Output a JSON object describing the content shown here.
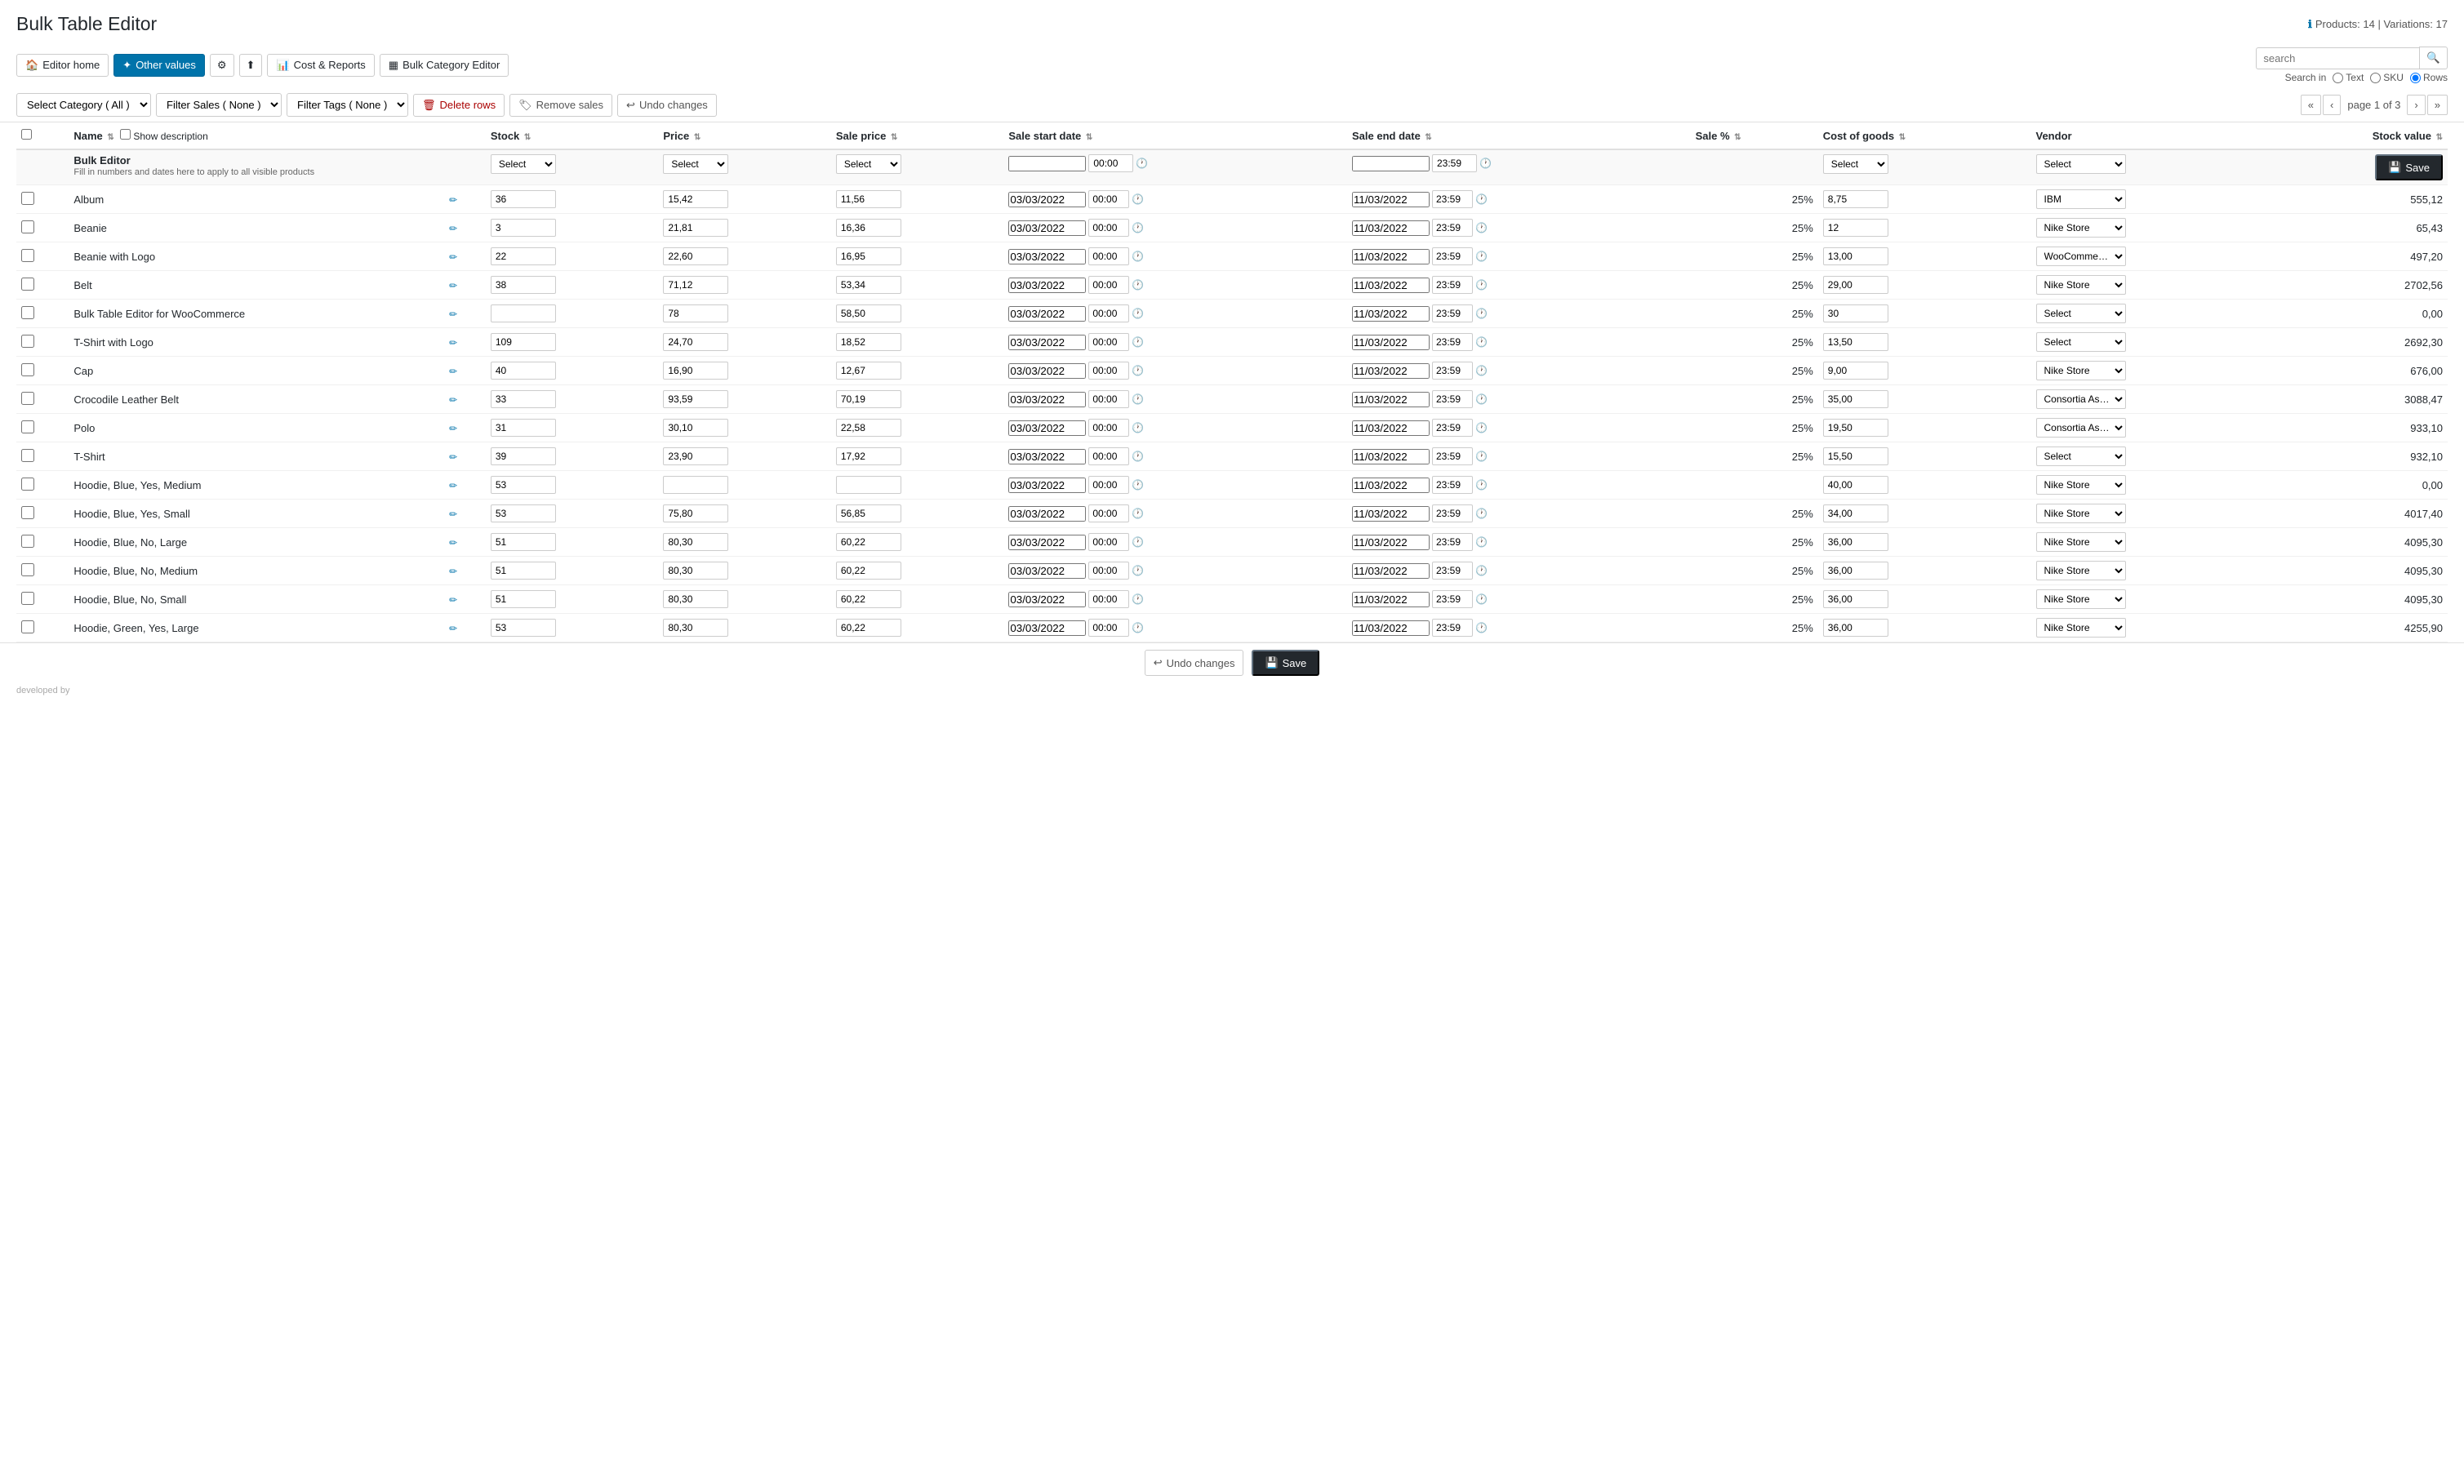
{
  "header": {
    "title": "Bulk Table Editor",
    "products_info": "Products: 14 | Variations: 17"
  },
  "toolbar": {
    "editor_home_label": "Editor home",
    "other_values_label": "Other values",
    "settings_label": "Settings",
    "upload_label": "Upload",
    "cost_reports_label": "Cost & Reports",
    "bulk_category_editor_label": "Bulk Category Editor",
    "search_placeholder": "search",
    "search_in_label": "Search in",
    "text_label": "Text",
    "sku_label": "SKU",
    "rows_label": "Rows"
  },
  "filters": {
    "category_label": "Select Category ( All )",
    "sales_label": "Filter Sales ( None )",
    "tags_label": "Filter Tags ( None )",
    "delete_rows_label": "Delete rows",
    "remove_sales_label": "Remove sales",
    "undo_changes_label": "Undo changes"
  },
  "pagination": {
    "page_info": "page 1 of 3",
    "first": "«",
    "prev": "‹",
    "next": "›",
    "last": "»"
  },
  "table": {
    "columns": [
      "Name",
      "Stock",
      "Price",
      "Sale price",
      "Sale start date",
      "Sale end date",
      "Sale %",
      "Cost of goods",
      "Vendor",
      "Stock value"
    ],
    "bulk_editor": {
      "title": "Bulk Editor",
      "description": "Fill in numbers and dates here to apply to all visible products",
      "stock_select": "Select",
      "price_select": "Select",
      "sale_price_select": "Select",
      "start_time": "00:00",
      "end_time": "23:59",
      "cost_select": "Select",
      "vendor_select": "Select",
      "save_label": "Save"
    },
    "rows": [
      {
        "name": "Album",
        "stock": "36",
        "price": "15,42",
        "sale_price": "11,56",
        "sale_start": "03/03/2022",
        "start_time": "00:00",
        "sale_end": "11/03/2022",
        "end_time": "23:59",
        "sale_pct": "25%",
        "cost": "8,75",
        "vendor": "IBM",
        "stock_val": "555,12"
      },
      {
        "name": "Beanie",
        "stock": "3",
        "price": "21,81",
        "sale_price": "16,36",
        "sale_start": "03/03/2022",
        "start_time": "00:00",
        "sale_end": "11/03/2022",
        "end_time": "23:59",
        "sale_pct": "25%",
        "cost": "12",
        "vendor": "Nike Store",
        "stock_val": "65,43"
      },
      {
        "name": "Beanie with Logo",
        "stock": "22",
        "price": "22,60",
        "sale_price": "16,95",
        "sale_start": "03/03/2022",
        "start_time": "00:00",
        "sale_end": "11/03/2022",
        "end_time": "23:59",
        "sale_pct": "25%",
        "cost": "13,00",
        "vendor": "WooComme…",
        "stock_val": "497,20"
      },
      {
        "name": "Belt",
        "stock": "38",
        "price": "71,12",
        "sale_price": "53,34",
        "sale_start": "03/03/2022",
        "start_time": "00:00",
        "sale_end": "11/03/2022",
        "end_time": "23:59",
        "sale_pct": "25%",
        "cost": "29,00",
        "vendor": "Nike Store",
        "stock_val": "2702,56"
      },
      {
        "name": "Bulk Table Editor for WooCommerce",
        "stock": "",
        "price": "78",
        "sale_price": "58,50",
        "sale_start": "03/03/2022",
        "start_time": "00:00",
        "sale_end": "11/03/2022",
        "end_time": "23:59",
        "sale_pct": "25%",
        "cost": "30",
        "vendor": "Select",
        "stock_val": "0,00"
      },
      {
        "name": "T-Shirt with Logo",
        "stock": "109",
        "price": "24,70",
        "sale_price": "18,52",
        "sale_start": "03/03/2022",
        "start_time": "00:00",
        "sale_end": "11/03/2022",
        "end_time": "23:59",
        "sale_pct": "25%",
        "cost": "13,50",
        "vendor": "Select",
        "stock_val": "2692,30"
      },
      {
        "name": "Cap",
        "stock": "40",
        "price": "16,90",
        "sale_price": "12,67",
        "sale_start": "03/03/2022",
        "start_time": "00:00",
        "sale_end": "11/03/2022",
        "end_time": "23:59",
        "sale_pct": "25%",
        "cost": "9,00",
        "vendor": "Nike Store",
        "stock_val": "676,00"
      },
      {
        "name": "Crocodile Leather Belt",
        "stock": "33",
        "price": "93,59",
        "sale_price": "70,19",
        "sale_start": "03/03/2022",
        "start_time": "00:00",
        "sale_end": "11/03/2022",
        "end_time": "23:59",
        "sale_pct": "25%",
        "cost": "35,00",
        "vendor": "Consortia As…",
        "stock_val": "3088,47"
      },
      {
        "name": "Polo",
        "stock": "31",
        "price": "30,10",
        "sale_price": "22,58",
        "sale_start": "03/03/2022",
        "start_time": "00:00",
        "sale_end": "11/03/2022",
        "end_time": "23:59",
        "sale_pct": "25%",
        "cost": "19,50",
        "vendor": "Consortia As…",
        "stock_val": "933,10"
      },
      {
        "name": "T-Shirt",
        "stock": "39",
        "price": "23,90",
        "sale_price": "17,92",
        "sale_start": "03/03/2022",
        "start_time": "00:00",
        "sale_end": "11/03/2022",
        "end_time": "23:59",
        "sale_pct": "25%",
        "cost": "15,50",
        "vendor": "Select",
        "stock_val": "932,10"
      },
      {
        "name": "Hoodie, Blue, Yes, Medium",
        "stock": "53",
        "price": "",
        "sale_price": "",
        "sale_start": "03/03/2022",
        "start_time": "00:00",
        "sale_end": "11/03/2022",
        "end_time": "23:59",
        "sale_pct": "",
        "cost": "40,00",
        "vendor": "Nike Store",
        "stock_val": "0,00"
      },
      {
        "name": "Hoodie, Blue, Yes, Small",
        "stock": "53",
        "price": "75,80",
        "sale_price": "56,85",
        "sale_start": "03/03/2022",
        "start_time": "00:00",
        "sale_end": "11/03/2022",
        "end_time": "23:59",
        "sale_pct": "25%",
        "cost": "34,00",
        "vendor": "Nike Store",
        "stock_val": "4017,40"
      },
      {
        "name": "Hoodie, Blue, No, Large",
        "stock": "51",
        "price": "80,30",
        "sale_price": "60,22",
        "sale_start": "03/03/2022",
        "start_time": "00:00",
        "sale_end": "11/03/2022",
        "end_time": "23:59",
        "sale_pct": "25%",
        "cost": "36,00",
        "vendor": "Nike Store",
        "stock_val": "4095,30"
      },
      {
        "name": "Hoodie, Blue, No, Medium",
        "stock": "51",
        "price": "80,30",
        "sale_price": "60,22",
        "sale_start": "03/03/2022",
        "start_time": "00:00",
        "sale_end": "11/03/2022",
        "end_time": "23:59",
        "sale_pct": "25%",
        "cost": "36,00",
        "vendor": "Nike Store",
        "stock_val": "4095,30"
      },
      {
        "name": "Hoodie, Blue, No, Small",
        "stock": "51",
        "price": "80,30",
        "sale_price": "60,22",
        "sale_start": "03/03/2022",
        "start_time": "00:00",
        "sale_end": "11/03/2022",
        "end_time": "23:59",
        "sale_pct": "25%",
        "cost": "36,00",
        "vendor": "Nike Store",
        "stock_val": "4095,30"
      },
      {
        "name": "Hoodie, Green, Yes, Large",
        "stock": "53",
        "price": "80,30",
        "sale_price": "60,22",
        "sale_start": "03/03/2022",
        "start_time": "00:00",
        "sale_end": "11/03/2022",
        "end_time": "23:59",
        "sale_pct": "25%",
        "cost": "36,00",
        "vendor": "Nike Store",
        "stock_val": "4255,90"
      }
    ]
  },
  "bottom_bar": {
    "undo_label": "Undo changes",
    "save_label": "Save"
  },
  "developed_by": "developed by"
}
